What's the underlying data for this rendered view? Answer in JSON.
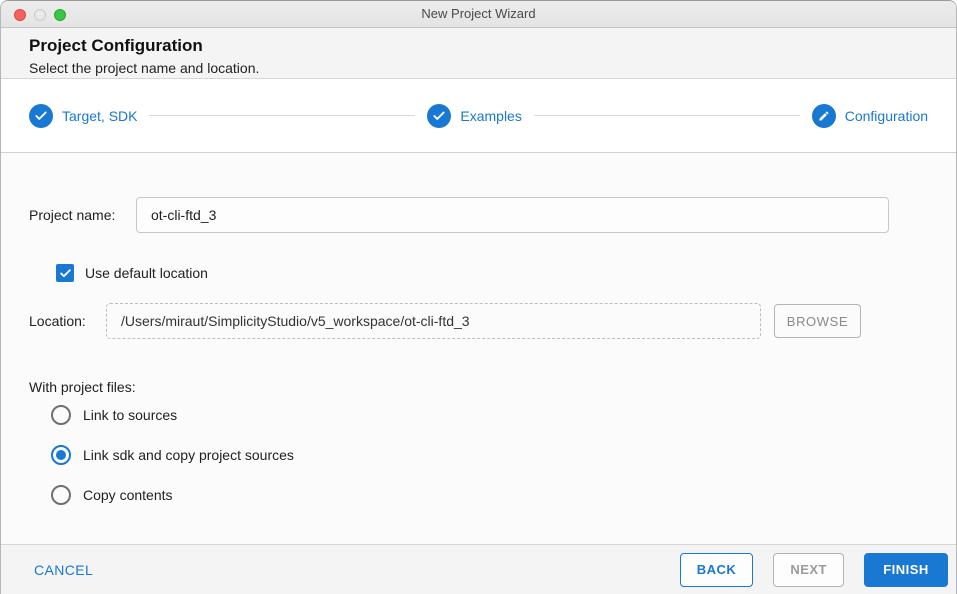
{
  "window": {
    "title": "New Project Wizard"
  },
  "header": {
    "title": "Project Configuration",
    "subtitle": "Select the project name and location."
  },
  "stepper": {
    "steps": [
      {
        "label": "Target, SDK",
        "icon": "check-icon",
        "state": "complete"
      },
      {
        "label": "Examples",
        "icon": "check-icon",
        "state": "complete"
      },
      {
        "label": "Configuration",
        "icon": "pencil-icon",
        "state": "current"
      }
    ]
  },
  "form": {
    "project_name": {
      "label": "Project name:",
      "value": "ot-cli-ftd_3"
    },
    "use_default_location": {
      "label": "Use default location",
      "checked": true
    },
    "location": {
      "label": "Location:",
      "value": "/Users/miraut/SimplicityStudio/v5_workspace/ot-cli-ftd_3",
      "browse_label": "BROWSE",
      "disabled": true
    },
    "with_project_files": {
      "label": "With project files:",
      "options": [
        {
          "label": "Link to sources",
          "selected": false
        },
        {
          "label": "Link sdk and copy project sources",
          "selected": true
        },
        {
          "label": "Copy contents",
          "selected": false
        }
      ]
    }
  },
  "footer": {
    "cancel_label": "CANCEL",
    "back_label": "BACK",
    "next_label": "NEXT",
    "next_disabled": true,
    "finish_label": "FINISH"
  },
  "colors": {
    "accent": "#1878d2",
    "disabled_text": "#9a9a9a",
    "header_bg": "#f4f4f4",
    "content_bg": "#fbfbfb"
  }
}
